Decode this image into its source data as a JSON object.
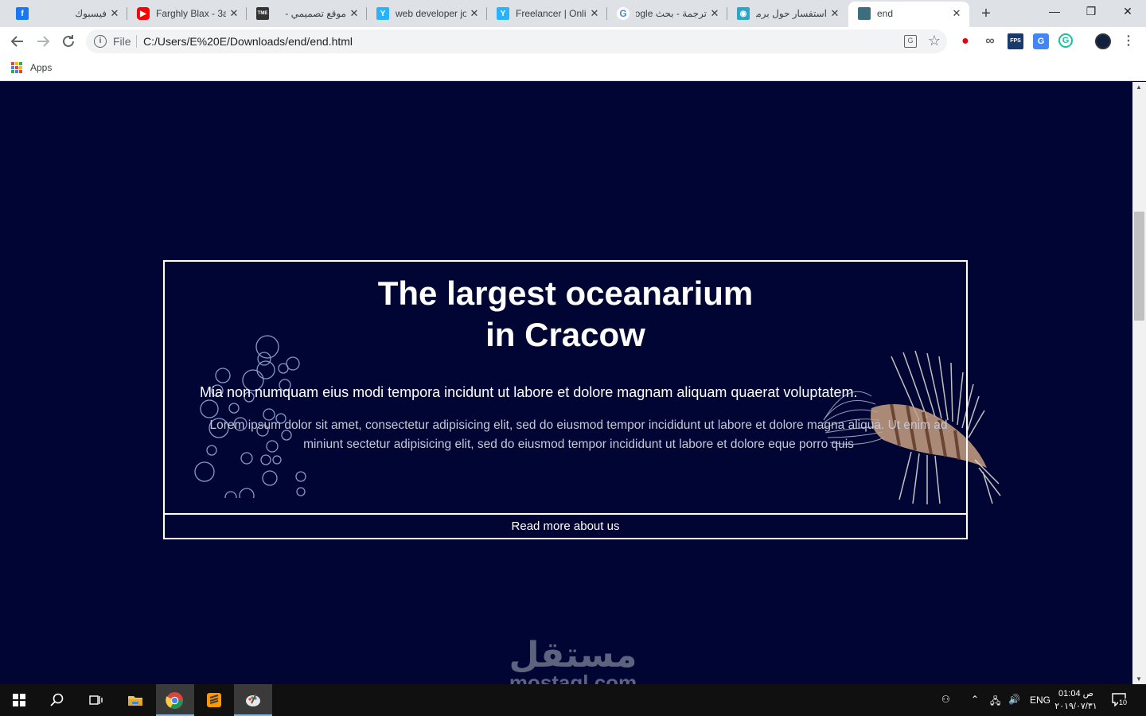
{
  "browser": {
    "tabs": [
      {
        "title": "فيسبوك",
        "icon": "facebook-icon",
        "rtl": true,
        "color": "#1877f2"
      },
      {
        "title": "Farghly Blax - 3a",
        "icon": "youtube-icon",
        "rtl": false,
        "color": "#ff0000"
      },
      {
        "title": "موقع تصميمي -",
        "icon": "tme-icon",
        "rtl": true,
        "color": "#333333"
      },
      {
        "title": "web developer jo",
        "icon": "freelancer-icon",
        "rtl": false,
        "color": "#29b2fe"
      },
      {
        "title": "Freelancer | Onli",
        "icon": "freelancer-icon",
        "rtl": false,
        "color": "#29b2fe"
      },
      {
        "title": "ترجمة - بحث Google",
        "icon": "google-icon",
        "rtl": true,
        "color": "#4285f4"
      },
      {
        "title": "استفسار حول برمج",
        "icon": "mostaql-icon",
        "rtl": true,
        "color": "#2ba6cb"
      },
      {
        "title": "end",
        "icon": "page-thumbnail-icon",
        "rtl": false,
        "color": "#3b6f80"
      }
    ],
    "new_tab": "+",
    "window_controls": {
      "minimize": "—",
      "maximize": "❐",
      "close": "✕"
    },
    "address": {
      "scheme": "File",
      "url": "C:/Users/E%20E/Downloads/end/end.html"
    },
    "bookmarks": {
      "apps_label": "Apps"
    }
  },
  "page": {
    "headline_line1": "The largest oceanarium",
    "headline_line2": "in Cracow",
    "subheading": "Mia non numquam eius modi tempora incidunt ut labore et dolore magnam aliquam quaerat voluptatem.",
    "body": "Lorem ipsum dolor sit amet, consectetur adipisicing elit, sed do eiusmod tempor incididunt ut labore et dolore magna aliqua. Ut enim ad miniunt sectetur adipisicing elit, sed do eiusmod tempor incididunt ut labore et dolore eque porro quis",
    "read_more": "Read more about us",
    "background_color": "#000533"
  },
  "watermark": {
    "arabic": "مستقل",
    "latin": "mostaql.com"
  },
  "taskbar": {
    "language": "ENG",
    "time": "01:04 ص",
    "date": "٢٠١٩/٠٧/٣١",
    "notification_count": "10"
  }
}
